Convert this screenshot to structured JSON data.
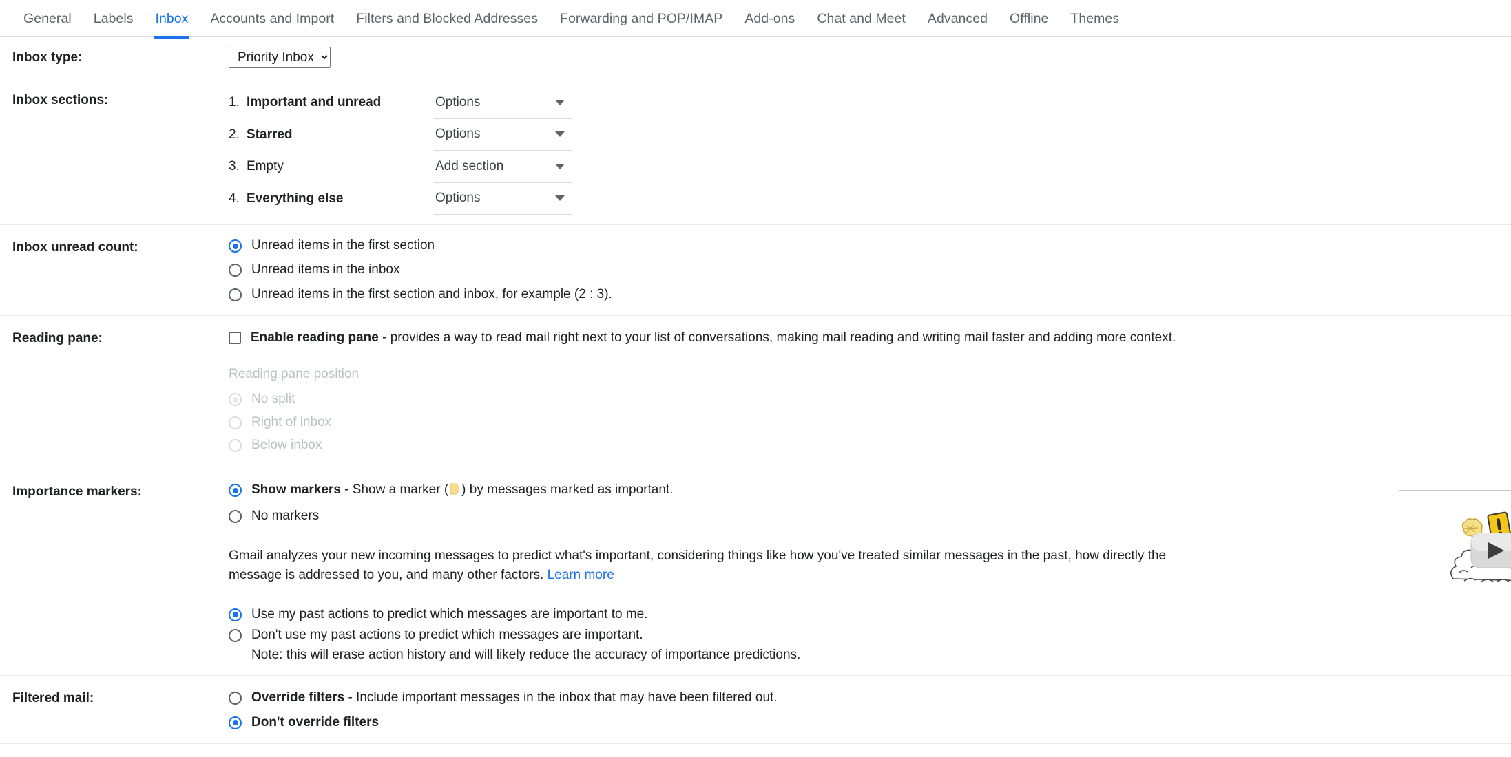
{
  "tabs": [
    {
      "label": "General",
      "active": false
    },
    {
      "label": "Labels",
      "active": false
    },
    {
      "label": "Inbox",
      "active": true
    },
    {
      "label": "Accounts and Import",
      "active": false
    },
    {
      "label": "Filters and Blocked Addresses",
      "active": false
    },
    {
      "label": "Forwarding and POP/IMAP",
      "active": false
    },
    {
      "label": "Add-ons",
      "active": false
    },
    {
      "label": "Chat and Meet",
      "active": false
    },
    {
      "label": "Advanced",
      "active": false
    },
    {
      "label": "Offline",
      "active": false
    },
    {
      "label": "Themes",
      "active": false
    }
  ],
  "inbox_type": {
    "label": "Inbox type:",
    "selected": "Priority Inbox",
    "options": [
      "Priority Inbox"
    ]
  },
  "inbox_sections": {
    "label": "Inbox sections:",
    "items": [
      {
        "num": "1.",
        "name": "Important and unread",
        "bold": true,
        "dropdown": "Options"
      },
      {
        "num": "2.",
        "name": "Starred",
        "bold": true,
        "dropdown": "Options"
      },
      {
        "num": "3.",
        "name": "Empty",
        "bold": false,
        "dropdown": "Add section"
      },
      {
        "num": "4.",
        "name": "Everything else",
        "bold": true,
        "dropdown": "Options"
      }
    ]
  },
  "inbox_unread_count": {
    "label": "Inbox unread count:",
    "options": [
      {
        "text": "Unread items in the first section",
        "checked": true
      },
      {
        "text": "Unread items in the inbox",
        "checked": false
      },
      {
        "text": "Unread items in the first section and inbox, for example (2 : 3).",
        "checked": false
      }
    ]
  },
  "reading_pane": {
    "label": "Reading pane:",
    "enable_bold": "Enable reading pane",
    "enable_rest": " - provides a way to read mail right next to your list of conversations, making mail reading and writing mail faster and adding more context.",
    "enable_checked": false,
    "position_title": "Reading pane position",
    "position_options": [
      {
        "text": "No split",
        "checked": true
      },
      {
        "text": "Right of inbox",
        "checked": false
      },
      {
        "text": "Below inbox",
        "checked": false
      }
    ]
  },
  "importance_markers": {
    "label": "Importance markers:",
    "show_markers_bold": "Show markers",
    "show_markers_pre": " - Show a marker (",
    "show_markers_post": ") by messages marked as important.",
    "show_markers_checked": true,
    "no_markers": "No markers",
    "no_markers_checked": false,
    "marker_color": "#fadd8f",
    "paragraph": "Gmail analyzes your new incoming messages to predict what's important, considering things like how you've treated similar messages in the past, how directly the message is addressed to you, and many other factors.",
    "learn_more": "Learn more",
    "past_actions": [
      {
        "text": "Use my past actions to predict which messages are important to me.",
        "checked": true
      },
      {
        "text": "Don't use my past actions to predict which messages are important.",
        "checked": false
      }
    ],
    "note": "Note: this will erase action history and will likely reduce the accuracy of importance predictions.",
    "video_thumbnail_name": "priority-inbox-video-thumbnail"
  },
  "filtered_mail": {
    "label": "Filtered mail:",
    "override_bold": "Override filters",
    "override_rest": " - Include important messages in the inbox that may have been filtered out.",
    "override_checked": false,
    "dont_override": "Don't override filters",
    "dont_override_checked": true
  },
  "colors": {
    "accent": "#1a73e8",
    "text": "#202124",
    "muted": "#5f6368",
    "disabled": "#bdc1c6",
    "divider": "#e8eaed",
    "marker_yellow": "#fadd8f"
  }
}
